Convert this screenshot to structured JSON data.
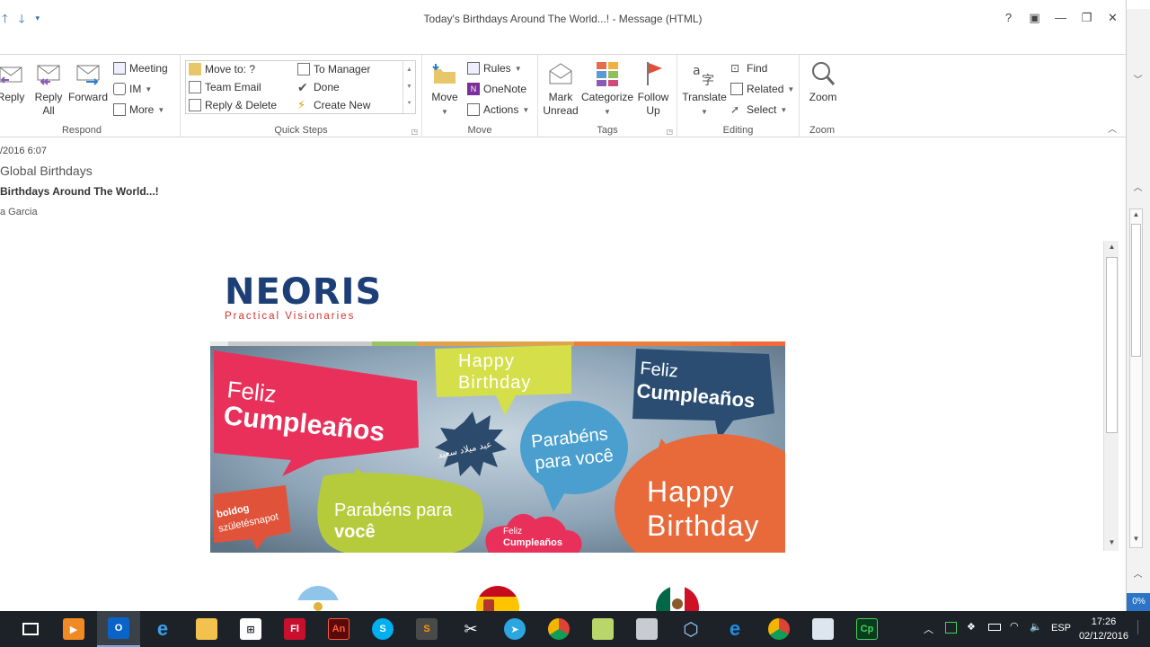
{
  "window": {
    "title": "Today's Birthdays Around The World...! - Message (HTML)",
    "controls": [
      "?",
      "▣",
      "—",
      "❐",
      "✕"
    ]
  },
  "ribbon": {
    "respond": {
      "label": "Respond",
      "reply": "Reply",
      "reply_all": "Reply All",
      "forward": "Forward",
      "meeting": "Meeting",
      "im": "IM",
      "more": "More"
    },
    "quick_steps": {
      "label": "Quick Steps",
      "items": [
        "Move to: ?",
        "To Manager",
        "Team Email",
        "Done",
        "Reply & Delete",
        "Create New"
      ]
    },
    "move": {
      "label": "Move",
      "move": "Move",
      "rules": "Rules",
      "onenote": "OneNote",
      "actions": "Actions"
    },
    "tags": {
      "label": "Tags",
      "mark_unread": "Mark Unread",
      "categorize": "Categorize",
      "follow_up": "Follow Up"
    },
    "editing": {
      "label": "Editing",
      "translate": "Translate",
      "find": "Find",
      "related": "Related",
      "select": "Select"
    },
    "zoom": {
      "label": "Zoom",
      "zoom": "Zoom"
    }
  },
  "message": {
    "timestamp": "/2016 6:07",
    "from": "Global Birthdays",
    "subject": "Birthdays Around The World...!",
    "to": "a Garcia"
  },
  "body": {
    "logo_name": "NEORIS",
    "logo_tagline": "Practical Visionaries",
    "banner": {
      "bubble1": [
        "Feliz",
        "Cumpleaños"
      ],
      "bubble2": [
        "Happy",
        "Birthday"
      ],
      "bubble3": [
        "Feliz",
        "Cumpleaños"
      ],
      "bubble4": "عيد ميلاد سعيد",
      "bubble5": [
        "Parabéns",
        "para você"
      ],
      "bubble6": [
        "Parabéns para",
        "você"
      ],
      "bubble7": [
        "Happy",
        "Birthday"
      ],
      "bubble8": [
        "boldog",
        "születésnapot"
      ],
      "bubble9": [
        "Feliz",
        "Cumpleaños"
      ]
    }
  },
  "side": {
    "zoom_pct": "0%"
  },
  "taskbar": {
    "language": "ESP",
    "time": "17:26",
    "date": "02/12/2016"
  }
}
